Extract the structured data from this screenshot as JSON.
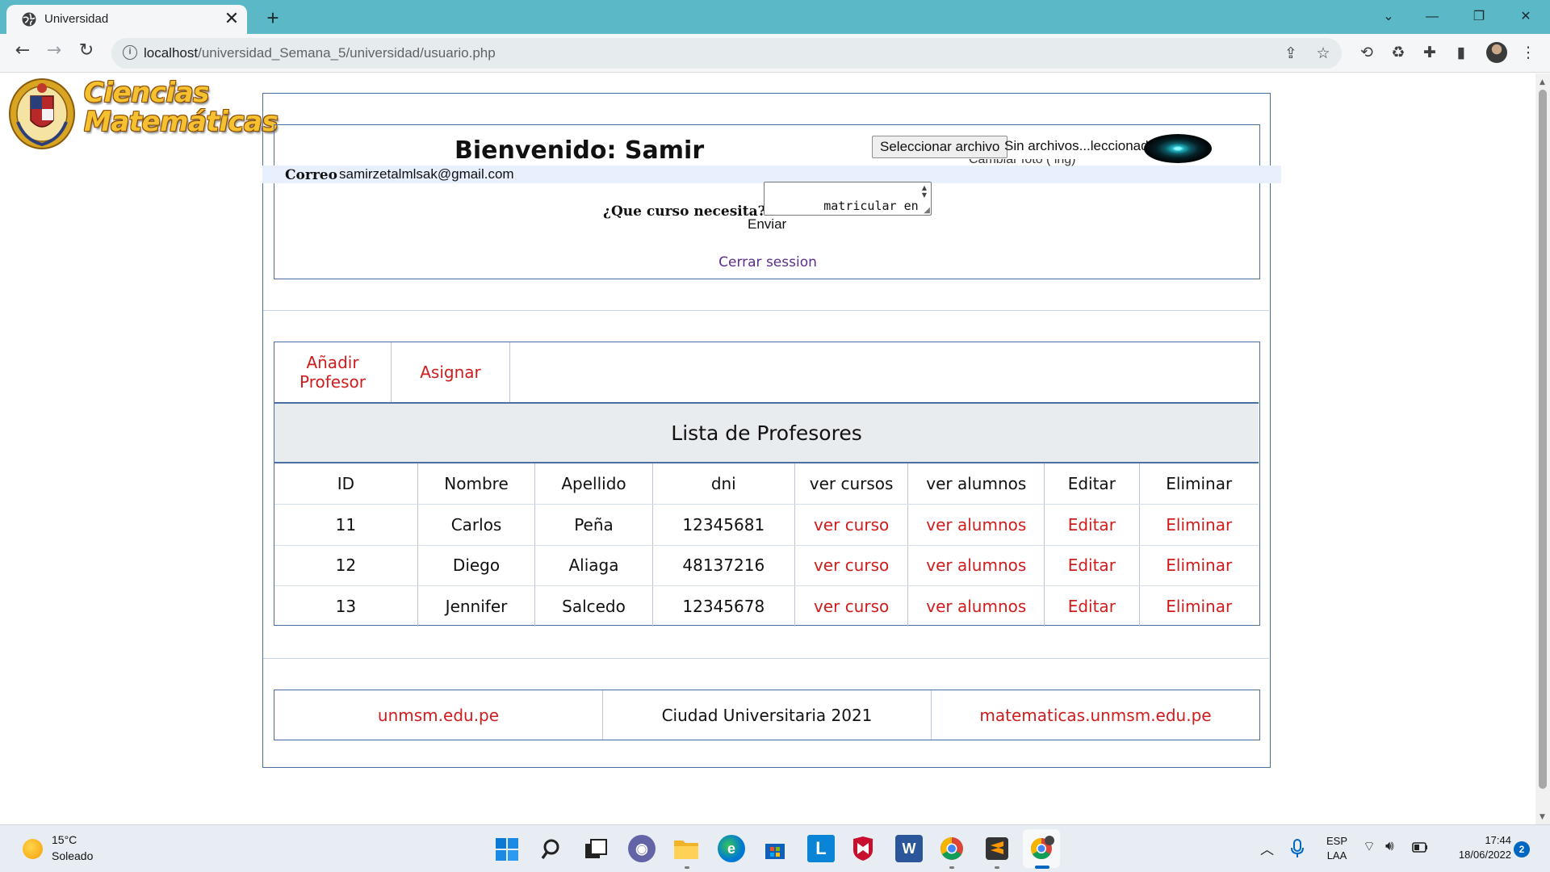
{
  "browser": {
    "tab_title": "Universidad",
    "tab_close": "✕",
    "new_tab": "+",
    "url_host": "localhost",
    "url_path": "/universidad_Semana_5/universidad/usuario.php",
    "window_controls": {
      "minimize": "—",
      "maximize": "❐",
      "close": "✕"
    }
  },
  "brand": {
    "title_line1": "Ciencias",
    "title_line2": "Matemáticas"
  },
  "user": {
    "welcome": "Bienvenido: Samir",
    "file_button": "Seleccionar archivo",
    "file_status": "Sin archivos...leccionados",
    "photo_caption": "Cambiar foto ( ing)",
    "correo_label": "Correo",
    "correo_value": "samirzetalmlsak@gmail.com",
    "curso_label": "¿Que curso necesita?",
    "curso_value": "matricular en\nCálculo Tensorial.",
    "enviar": "Enviar",
    "logout": "Cerrar session"
  },
  "menu": {
    "add_professor": "Añadir Profesor",
    "assign": "Asignar"
  },
  "professors": {
    "title": "Lista de Profesores",
    "headers": [
      "ID",
      "Nombre",
      "Apellido",
      "dni",
      "ver cursos",
      "ver alumnos",
      "Editar",
      "Eliminar"
    ],
    "rows": [
      {
        "id": "11",
        "nombre": "Carlos",
        "apellido": "Peña",
        "dni": "12345681",
        "cursos": "ver curso",
        "alumnos": "ver alumnos",
        "editar": "Editar",
        "eliminar": "Eliminar"
      },
      {
        "id": "12",
        "nombre": "Diego",
        "apellido": "Aliaga",
        "dni": "48137216",
        "cursos": "ver curso",
        "alumnos": "ver alumnos",
        "editar": "Editar",
        "eliminar": "Eliminar"
      },
      {
        "id": "13",
        "nombre": "Jennifer",
        "apellido": "Salcedo",
        "dni": "12345678",
        "cursos": "ver curso",
        "alumnos": "ver alumnos",
        "editar": "Editar",
        "eliminar": "Eliminar"
      }
    ]
  },
  "footer": {
    "left_link": "unmsm.edu.pe",
    "center": "Ciudad Universitaria 2021",
    "right_link": "matematicas.unmsm.edu.pe"
  },
  "taskbar": {
    "temperature": "15°C",
    "weather": "Soleado",
    "lang_line1": "ESP",
    "lang_line2": "LAA",
    "time": "17:44",
    "date": "18/06/2022",
    "notifications": "2",
    "word_letter": "W",
    "l_letter": "L"
  },
  "colors": {
    "accent_link": "#d01c1c",
    "border": "#4a6fa5",
    "chrome_tab_bar": "#5bb8c6",
    "logout_link": "#5a2e8a"
  },
  "icons": [
    "globe-icon",
    "back-arrow-icon",
    "forward-arrow-icon",
    "reload-icon",
    "info-icon",
    "share-icon",
    "star-icon",
    "extension-icon",
    "windows-start-icon",
    "search-icon",
    "chrome-icon"
  ]
}
